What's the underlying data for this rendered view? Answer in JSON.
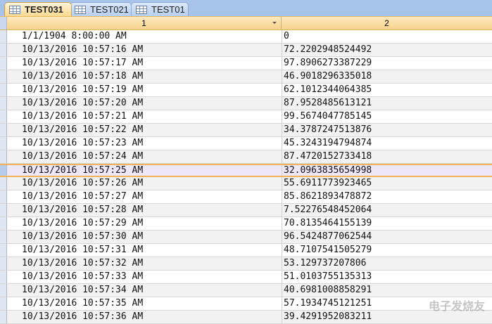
{
  "tabs": [
    {
      "label": "TEST031",
      "active": true
    },
    {
      "label": "TEST021"
    },
    {
      "label": "TEST01"
    }
  ],
  "columns": [
    "1",
    "2"
  ],
  "rows": [
    [
      "1/1/1904 8:00:00 AM",
      "0"
    ],
    [
      "10/13/2016 10:57:16 AM",
      "72.2202948524492"
    ],
    [
      "10/13/2016 10:57:17 AM",
      "97.8906273387229"
    ],
    [
      "10/13/2016 10:57:18 AM",
      "46.9018296335018"
    ],
    [
      "10/13/2016 10:57:19 AM",
      "62.1012344064385"
    ],
    [
      "10/13/2016 10:57:20 AM",
      "87.9528485613121"
    ],
    [
      "10/13/2016 10:57:21 AM",
      "99.5674047785145"
    ],
    [
      "10/13/2016 10:57:22 AM",
      "34.3787247513876"
    ],
    [
      "10/13/2016 10:57:23 AM",
      "45.3243194794874"
    ],
    [
      "10/13/2016 10:57:24 AM",
      "87.4720152733418"
    ],
    [
      "10/13/2016 10:57:25 AM",
      "32.0963835654998"
    ],
    [
      "10/13/2016 10:57:26 AM",
      "55.6911773923465"
    ],
    [
      "10/13/2016 10:57:27 AM",
      "85.8621893478872"
    ],
    [
      "10/13/2016 10:57:28 AM",
      "7.52276548452064"
    ],
    [
      "10/13/2016 10:57:29 AM",
      "70.8135464155139"
    ],
    [
      "10/13/2016 10:57:30 AM",
      "96.5424877062544"
    ],
    [
      "10/13/2016 10:57:31 AM",
      "48.7107541505279"
    ],
    [
      "10/13/2016 10:57:32 AM",
      "53.129737207806"
    ],
    [
      "10/13/2016 10:57:33 AM",
      "51.0103755135313"
    ],
    [
      "10/13/2016 10:57:34 AM",
      "40.6981008858291"
    ],
    [
      "10/13/2016 10:57:35 AM",
      "57.1934745121251"
    ],
    [
      "10/13/2016 10:57:36 AM",
      "39.4291952083211"
    ]
  ],
  "selected_row": 10,
  "watermark": "电子发烧友"
}
